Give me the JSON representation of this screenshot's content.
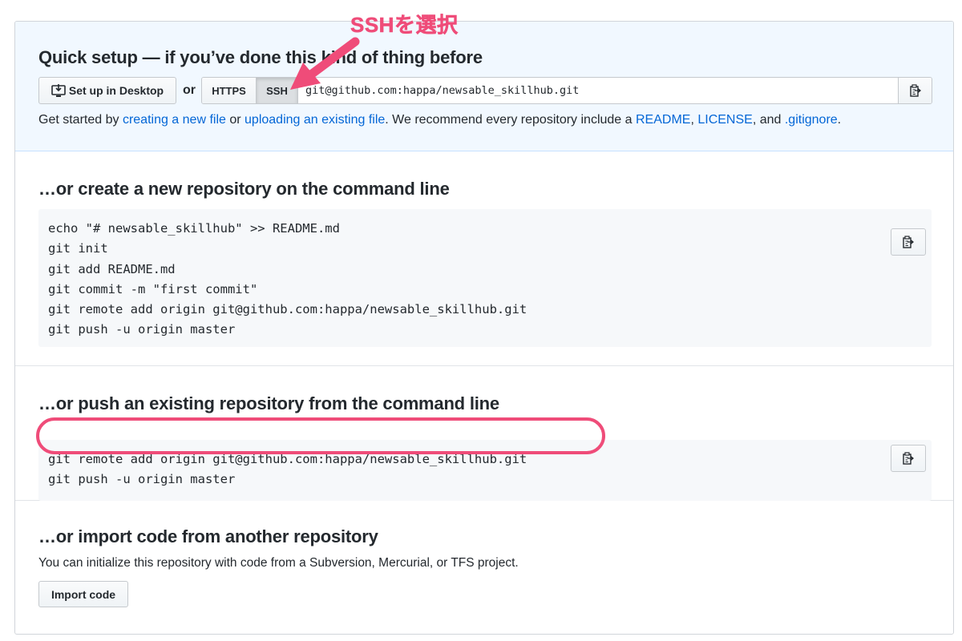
{
  "quick_setup": {
    "title": "Quick setup — if you’ve done this kind of thing before",
    "desktop_button": "Set up in Desktop",
    "or": "or",
    "https_label": "HTTPS",
    "ssh_label": "SSH",
    "clone_url": "git@github.com:happa/newsable_skillhub.git",
    "get_started": {
      "prefix": "Get started by ",
      "link_new_file": "creating a new file",
      "mid1": " or ",
      "link_upload": "uploading an existing file",
      "mid2": ". We recommend every repository include a ",
      "link_readme": "README",
      "comma": ", ",
      "link_license": "LICENSE",
      "mid3": ", and ",
      "link_gitignore": ".gitignore",
      "suffix": "."
    }
  },
  "create_section": {
    "title": "…or create a new repository on the command line",
    "lines": [
      "echo \"# newsable_skillhub\" >> README.md",
      "git init",
      "git add README.md",
      "git commit -m \"first commit\"",
      "git remote add origin git@github.com:happa/newsable_skillhub.git",
      "git push -u origin master"
    ]
  },
  "push_section": {
    "title": "…or push an existing repository from the command line",
    "lines": [
      "git remote add origin git@github.com:happa/newsable_skillhub.git",
      "git push -u origin master"
    ]
  },
  "import_section": {
    "title": "…or import code from another repository",
    "description": "You can initialize this repository with code from a Subversion, Mercurial, or TFS project.",
    "button": "Import code"
  },
  "annotation": {
    "label": "SSHを選択",
    "color": "#ef4c79"
  },
  "icons": {
    "desktop": "desktop-download-icon",
    "clipboard": "clipboard-icon"
  }
}
